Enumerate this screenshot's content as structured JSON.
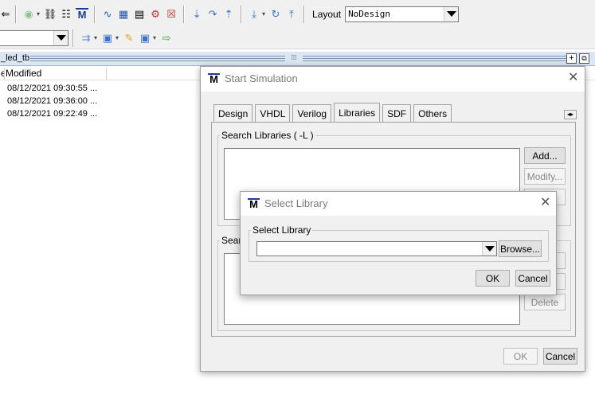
{
  "toolbar": {
    "layout_label": "Layout",
    "layout_value": "NoDesign",
    "row1_icons": [
      "back-arrow-icon",
      "stop-circle-icon",
      "binoculars-icon",
      "tree-icon",
      "modelsim-icon",
      "wave-icon",
      "compile-icon",
      "compile-all-icon",
      "simulate-icon",
      "break-icon",
      "step-into-icon",
      "step-over-icon",
      "step-out-icon",
      "down-icon",
      "restart-icon",
      "up-icon"
    ],
    "row2_icons": [
      "run-icon",
      "run-continue-icon",
      "run-all-icon",
      "restart-sim-icon",
      "run-length-icon"
    ]
  },
  "pane": {
    "title": "_led_tb",
    "columns": [
      "e",
      "Modified"
    ],
    "rows": [
      {
        "modified": "08/12/2021 09:30:55 ..."
      },
      {
        "modified": "08/12/2021 09:36:00 ..."
      },
      {
        "modified": "08/12/2021 09:22:49 ..."
      }
    ]
  },
  "start_sim": {
    "title": "Start Simulation",
    "tabs": [
      "Design",
      "VHDL",
      "Verilog",
      "Libraries",
      "SDF",
      "Others"
    ],
    "active_tab": "Libraries",
    "search_libraries_label": "Search Libraries ( -L )",
    "search_libraries_first_label": "Searc",
    "add_label": "Add...",
    "modify_label": "Modify...",
    "delete_label": "Delete",
    "ok_label": "OK",
    "cancel_label": "Cancel"
  },
  "select_library": {
    "title": "Select Library",
    "group_label": "Select Library",
    "input_value": "",
    "browse_label": "Browse...",
    "ok_label": "OK",
    "cancel_label": "Cancel"
  },
  "colors": {
    "pane_header": "#dbe6f4",
    "logo_bar": "#1f3a93",
    "default_button_border": "#0078d7"
  }
}
